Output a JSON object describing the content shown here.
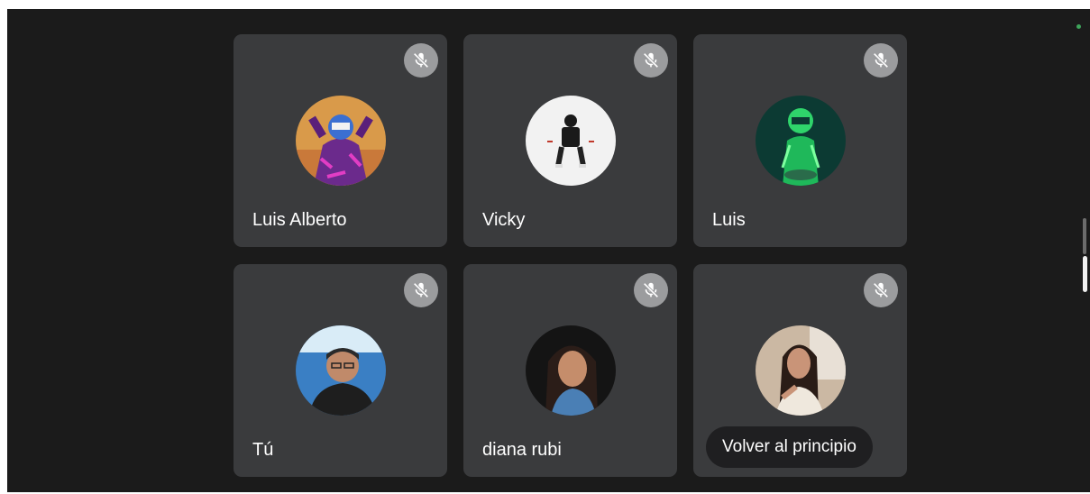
{
  "participants": [
    {
      "name": "Luis Alberto",
      "muted": true,
      "avatar": "avatar-graffiti-mask-person"
    },
    {
      "name": "Vicky",
      "muted": true,
      "avatar": "avatar-person-white-background"
    },
    {
      "name": "Luis",
      "muted": true,
      "avatar": "avatar-green-neon-figure"
    },
    {
      "name": "Tú",
      "muted": true,
      "avatar": "avatar-man-with-glasses"
    },
    {
      "name": "diana rubi",
      "muted": true,
      "avatar": "avatar-young-woman-dark-hair"
    },
    {
      "name": "",
      "muted": true,
      "avatar": "avatar-woman-selfie"
    }
  ],
  "tooltip": {
    "label": "Volver al principio"
  },
  "icons": {
    "mute": "mic-off-icon"
  },
  "colors": {
    "tile_bg": "#3a3b3d",
    "stage_bg": "#1b1b1b",
    "mute_bg": "#9b9c9e",
    "status": "#3ea55b"
  }
}
